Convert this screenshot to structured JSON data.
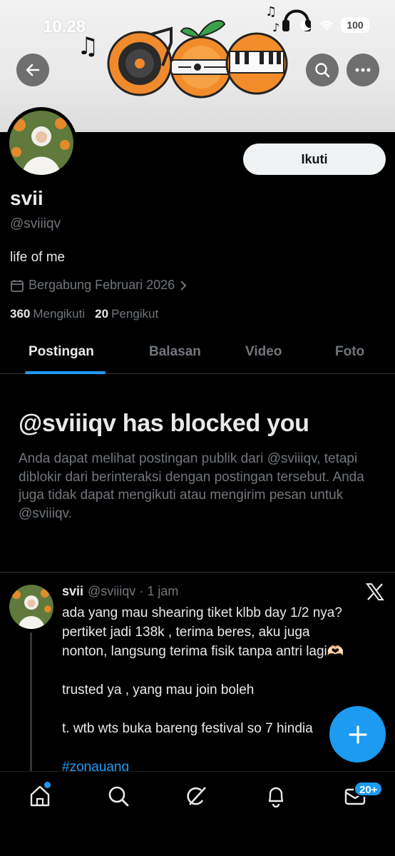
{
  "status_bar": {
    "time": "10.28",
    "battery": "100"
  },
  "profile": {
    "name": "svii",
    "handle": "@sviiiqv",
    "bio": "life of me",
    "joined": "Bergabung Februari 2026",
    "following_count": "360",
    "following_label": "Mengikuti",
    "followers_count": "20",
    "followers_label": "Pengikut",
    "follow_button": "Ikuti"
  },
  "tabs": [
    {
      "label": "Postingan",
      "active": true
    },
    {
      "label": "Balasan",
      "active": false
    },
    {
      "label": "Video",
      "active": false
    },
    {
      "label": "Foto",
      "active": false
    }
  ],
  "blocked": {
    "title": "@sviiiqv has blocked you",
    "description": "Anda dapat melihat postingan publik dari @sviiiqv, tetapi diblokir dari berinteraksi dengan postingan tersebut. Anda juga tidak dapat mengikuti atau mengirim pesan untuk @sviiiqv."
  },
  "post": {
    "author": "svii",
    "handle": "@sviiiqv",
    "time": "· 1 jam",
    "lines": [
      "ada yang mau shearing tiket klbb day 1/2 nya?",
      "pertiket jadi 138k , terima beres, aku juga",
      "nonton, langsung terima fisik tanpa antri lagi🫶🏻",
      "trusted ya , yang mau join boleh",
      "t. wtb wts buka bareng festival so 7 hindia",
      "#zonauang"
    ]
  },
  "bottom_nav": {
    "messages_badge": "20+"
  },
  "colors": {
    "accent": "#1d9bf0",
    "background": "#000000",
    "muted": "#71767b"
  },
  "icons": [
    "back-arrow-icon",
    "search-icon",
    "more-icon",
    "calendar-icon",
    "chevron-right-icon",
    "x-logo-icon",
    "plus-icon",
    "home-icon",
    "explore-icon",
    "grok-icon",
    "notifications-icon",
    "messages-icon"
  ]
}
